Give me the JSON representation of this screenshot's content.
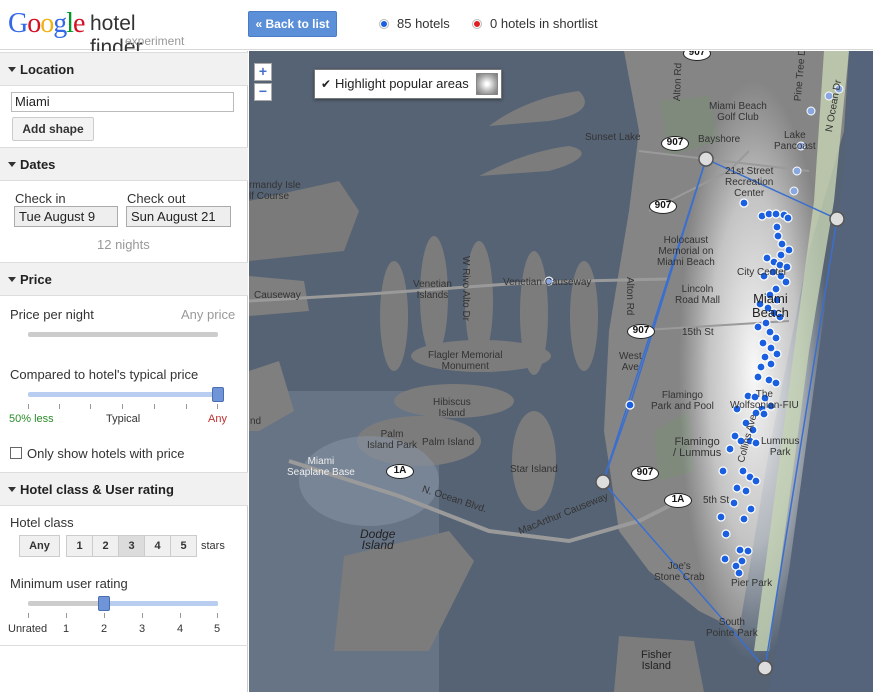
{
  "header": {
    "logo_google": "Google",
    "logo_product": "hotel finder",
    "logo_sub": "experiment",
    "back_label": "« Back to list",
    "hotels_count": "85 hotels",
    "shortlist_count": "0 hotels in shortlist",
    "hotels_dot_color": "#1a5fe0",
    "shortlist_dot_color": "#e02020"
  },
  "location": {
    "title": "Location",
    "value": "Miami",
    "add_shape": "Add shape"
  },
  "dates": {
    "title": "Dates",
    "checkin_label": "Check in",
    "checkout_label": "Check out",
    "checkin_value": "Tue August 9",
    "checkout_value": "Sun August 21",
    "nights": "12 nights"
  },
  "price": {
    "title": "Price",
    "per_night_label": "Price per night",
    "per_night_value": "Any price",
    "compared_label": "Compared to hotel's typical price",
    "compared_level": 1.0,
    "scale_left": "50% less",
    "scale_mid": "Typical",
    "scale_right": "Any",
    "only_with_price": "Only show hotels with price",
    "only_with_price_checked": false
  },
  "rating": {
    "title": "Hotel class & User rating",
    "class_label": "Hotel class",
    "class_any": "Any",
    "class_options": [
      "1",
      "2",
      "3",
      "4",
      "5"
    ],
    "class_selected": "3",
    "stars_suffix": "stars",
    "min_rating_label": "Minimum user rating",
    "min_rating_value": 2,
    "scale": [
      "Unrated",
      "1",
      "2",
      "3",
      "4",
      "5"
    ]
  },
  "map": {
    "zoom_in": "+",
    "zoom_out": "−",
    "highlight_label": "Highlight popular areas",
    "highlight_checked": true,
    "labels": {
      "sunset_lake": "Sunset Lake",
      "altos_del_mar": "Alton Rd",
      "miami_beach_golf": "Miami Beach\nGolf Club",
      "bayshore": "Bayshore",
      "lake_pancoast": "Lake\nPancoast",
      "recreation": "21st Street\nRecreation\nCenter",
      "holocaust": "Holocaust\nMemorial on\nMiami Beach",
      "lincoln": "Lincoln\nRoad Mall",
      "city_center": "City Center",
      "miami_beach": "Miami\nBeach",
      "fifteenth": "15th St",
      "west_ave": "West\nAve",
      "alton_rd": "Alton Rd",
      "flamingo_park": "Flamingo\nPark and Pool",
      "wolfsonian": "The\nWolfsonian-FIU",
      "flamingo_lummus": "Flamingo\n/ Lummus",
      "lummus_park": "Lummus\nPark",
      "fifth_st": "5th St",
      "collins": "Collins Ave",
      "joes": "Joe's\nStone Crab",
      "pier_park": "Pier Park",
      "south_pointe": "South\nPointe Park",
      "fisher": "Fisher\nIsland",
      "venetian_islands": "Venetian\nIslands",
      "venetian_causeway": "Venetian Causeway",
      "causeway_left": "Causeway",
      "w_rivo_alto": "W Rivo Alto Dr",
      "flagler": "Flagler Memorial\nMonument",
      "hibiscus": "Hibiscus\nIsland",
      "palm": "Palm\nIsland Park",
      "palm_island": "Palm Island",
      "star_island": "Star Island",
      "seaplane": "Miami\nSeaplane Base",
      "ocean_blvd": "N. Ocean Blvd.",
      "macarthur": "MacArthur Causeway",
      "dodge": "Dodge\nIsland",
      "normandy": "rmandy Isle\nlf Course",
      "pine_tree": "Pine Tree Dr",
      "n_ocean": "N Ocean Dr",
      "left_nd": "nd"
    },
    "road_signs": [
      "907",
      "907",
      "907",
      "907",
      "907",
      "1A",
      "1A"
    ]
  }
}
